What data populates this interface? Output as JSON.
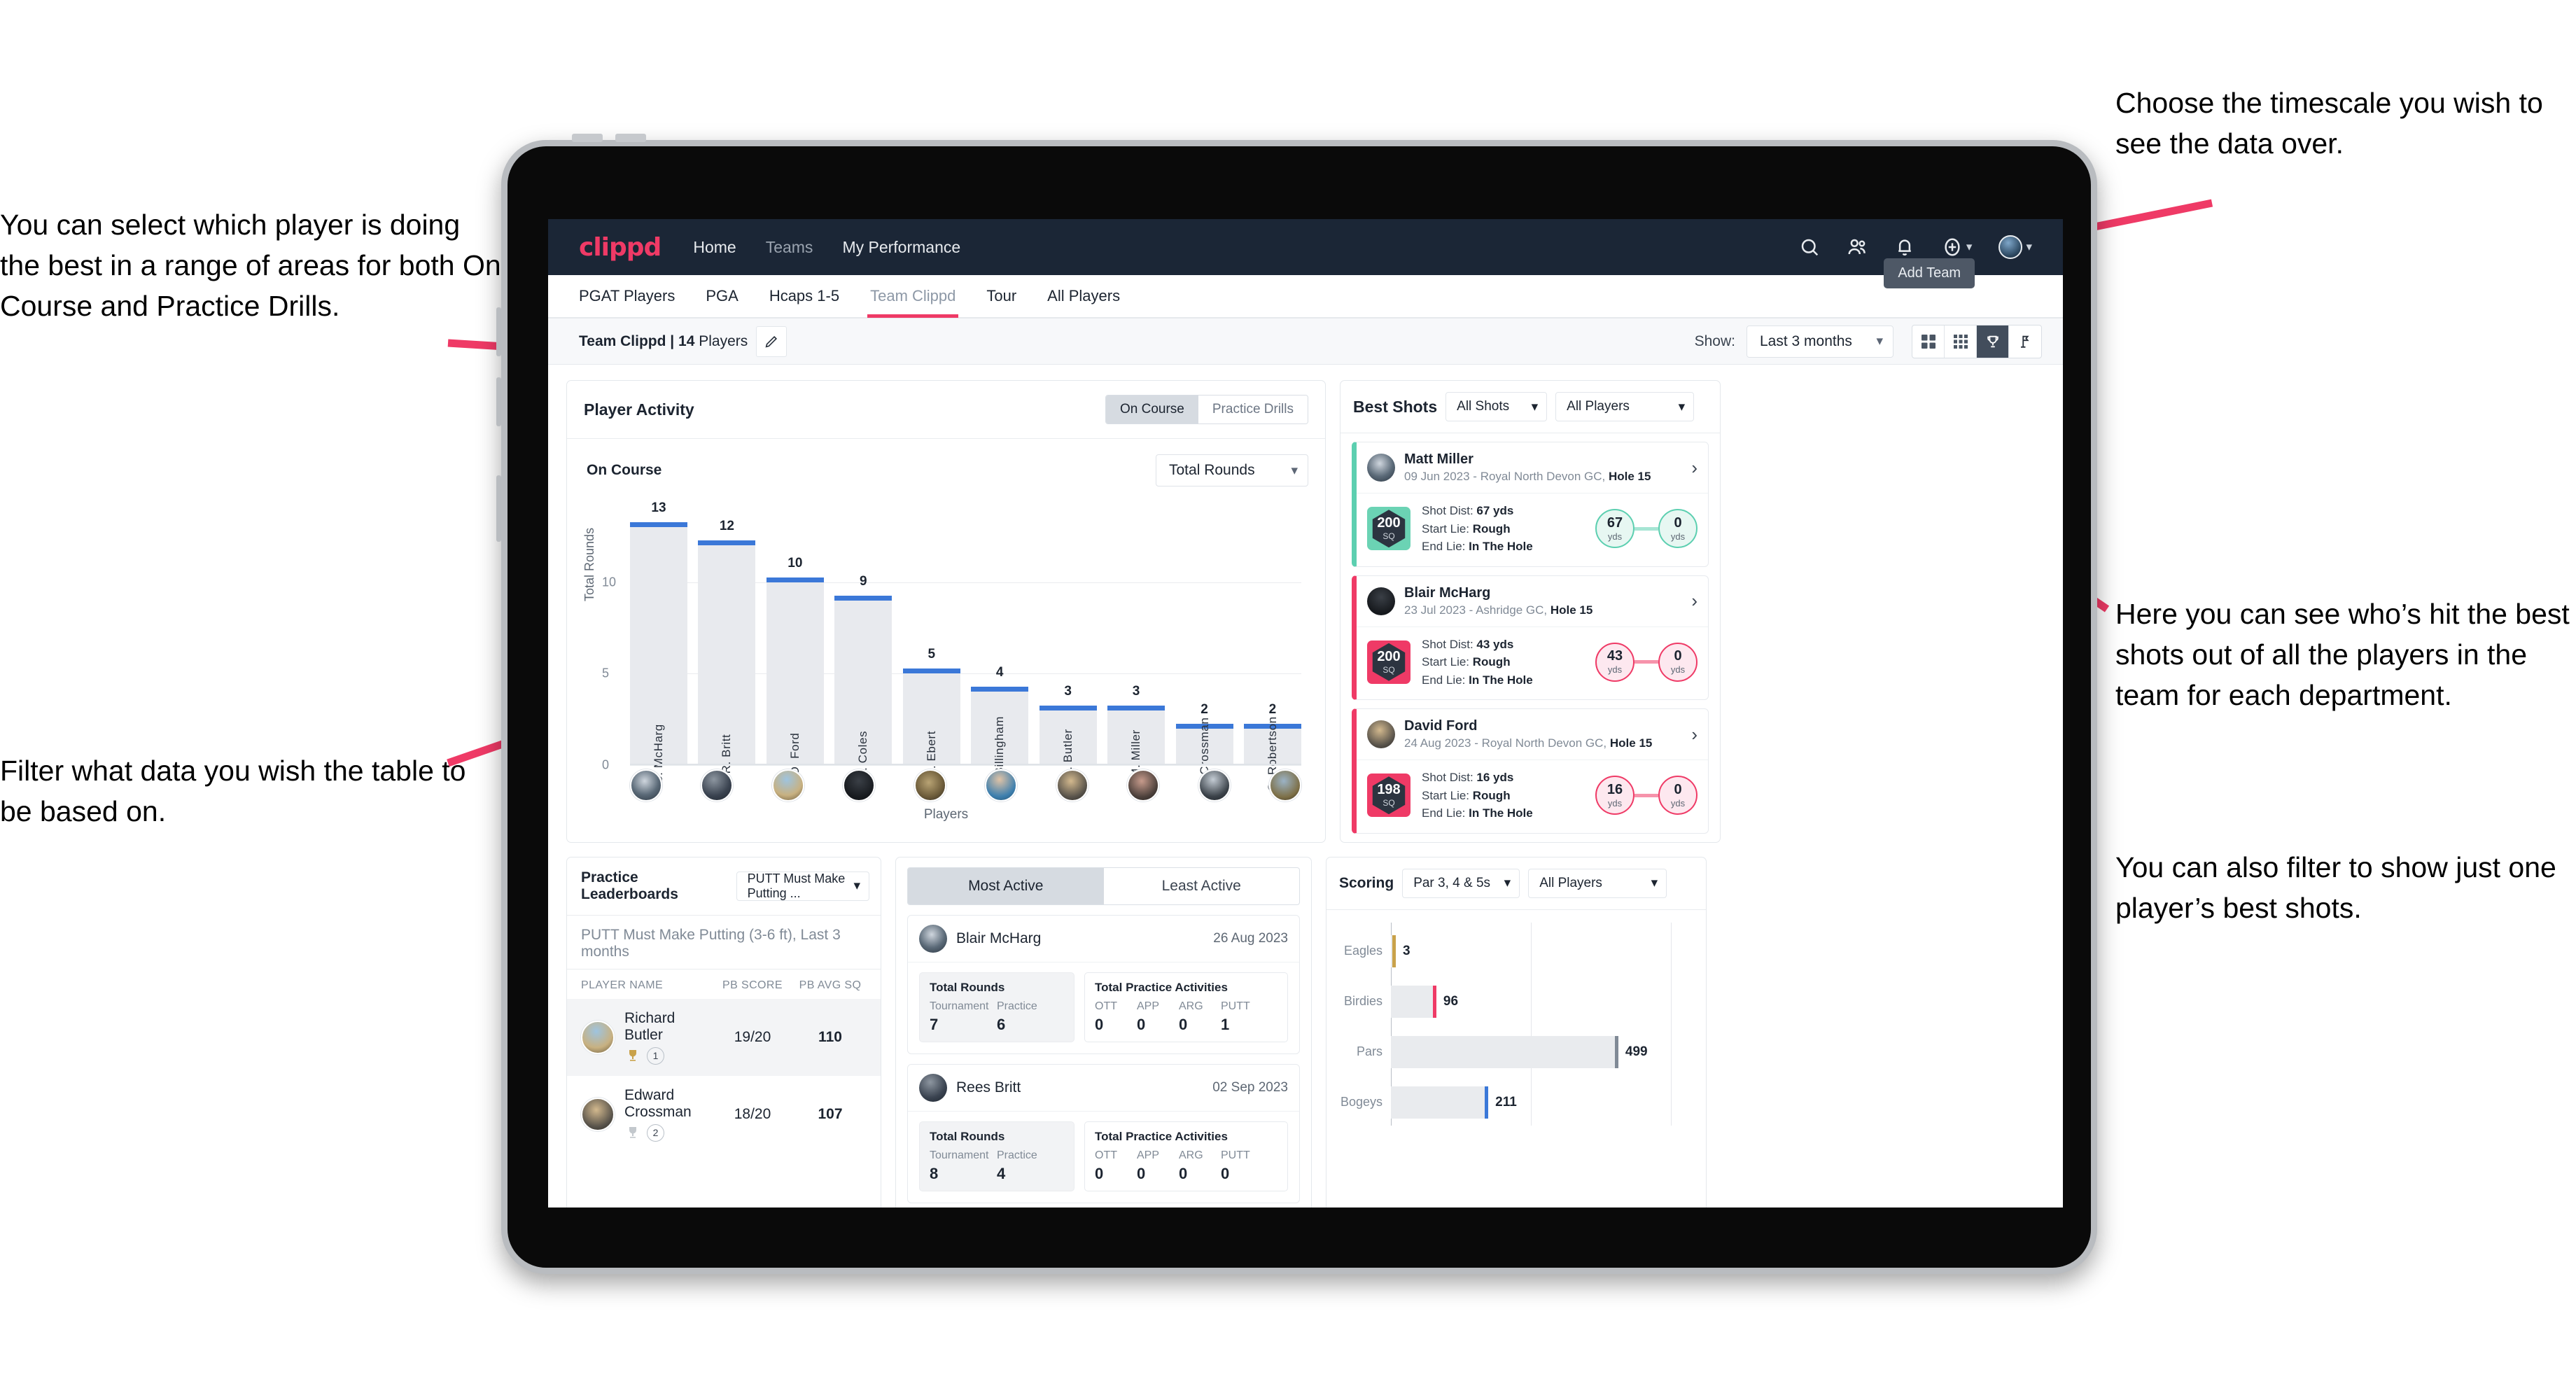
{
  "annotations": {
    "left_top": "You can select which player is doing the best in a range of areas for both On Course and Practice Drills.",
    "left_bottom": "Filter what data you wish the table to be based on.",
    "right_top": "Choose the timescale you wish to see the data over.",
    "right_middle": "Here you can see who’s hit the best shots out of all the players in the team for each department.",
    "right_bottom": "You can also filter to show just one player’s best shots."
  },
  "navbar": {
    "brand": "clippd",
    "links": [
      {
        "label": "Home",
        "active": true
      },
      {
        "label": "Teams",
        "active": false
      },
      {
        "label": "My Performance",
        "active": true
      }
    ],
    "icons": [
      "search-icon",
      "people-icon",
      "bell-icon",
      "plus-circle-icon",
      "avatar"
    ]
  },
  "tabs": [
    {
      "label": "PGAT Players",
      "active": false
    },
    {
      "label": "PGA",
      "active": false
    },
    {
      "label": "Hcaps 1-5",
      "active": false
    },
    {
      "label": "Team Clippd",
      "active": true
    },
    {
      "label": "Tour",
      "active": false
    },
    {
      "label": "All Players",
      "active": false
    }
  ],
  "tooltip": {
    "add_team": "Add Team"
  },
  "subbar": {
    "team_name": "Team Clippd",
    "separator": "|",
    "player_count": "14",
    "players_word": "Players",
    "show_label": "Show:",
    "timescale": "Last 3 months",
    "view_buttons": [
      "grid-large-icon",
      "grid-small-icon",
      "trophy-icon",
      "flag-icon"
    ],
    "selected_view": "trophy-icon"
  },
  "player_activity": {
    "title": "Player Activity",
    "segments": [
      {
        "label": "On Course",
        "active": true
      },
      {
        "label": "Practice Drills",
        "active": false
      }
    ],
    "sub_label": "On Course",
    "metric_select": "Total Rounds"
  },
  "best_shots": {
    "title": "Best Shots",
    "shot_filter": "All Shots",
    "player_filter": "All Players",
    "cards": [
      {
        "player": "Matt Miller",
        "meta_date": "09 Jun 2023",
        "meta_course": "Royal North Devon GC,",
        "meta_hole": "Hole 15",
        "sq": "200",
        "sq_unit": "SQ",
        "shot_dist_label": "Shot Dist:",
        "shot_dist": "67 yds",
        "start_lie_label": "Start Lie:",
        "start_lie": "Rough",
        "end_lie_label": "End Lie:",
        "end_lie": "In The Hole",
        "from_value": "67",
        "from_unit": "yds",
        "to_value": "0",
        "to_unit": "yds",
        "accent": "#5ccfb0"
      },
      {
        "player": "Blair McHarg",
        "meta_date": "23 Jul 2023",
        "meta_course": "Ashridge GC,",
        "meta_hole": "Hole 15",
        "sq": "200",
        "sq_unit": "SQ",
        "shot_dist_label": "Shot Dist:",
        "shot_dist": "43 yds",
        "start_lie_label": "Start Lie:",
        "start_lie": "Rough",
        "end_lie_label": "End Lie:",
        "end_lie": "In The Hole",
        "from_value": "43",
        "from_unit": "yds",
        "to_value": "0",
        "to_unit": "yds",
        "accent": "#ef3a66"
      },
      {
        "player": "David Ford",
        "meta_date": "24 Aug 2023",
        "meta_course": "Royal North Devon GC,",
        "meta_hole": "Hole 15",
        "sq": "198",
        "sq_unit": "SQ",
        "shot_dist_label": "Shot Dist:",
        "shot_dist": "16 yds",
        "start_lie_label": "Start Lie:",
        "start_lie": "Rough",
        "end_lie_label": "End Lie:",
        "end_lie": "In The Hole",
        "from_value": "16",
        "from_unit": "yds",
        "to_value": "0",
        "to_unit": "yds",
        "accent": "#ef3a66"
      }
    ]
  },
  "practice_leaderboards": {
    "title": "Practice Leaderboards",
    "drill_select": "PUTT Must Make Putting ...",
    "subtitle_bold": "PUTT Must Make Putting (3-6 ft),",
    "subtitle_light": "Last 3 months",
    "columns": [
      "PLAYER NAME",
      "PB SCORE",
      "PB AVG SQ"
    ],
    "rows": [
      {
        "name": "Richard Butler",
        "rank": "1",
        "pb_score": "19/20",
        "pb_avg_sq": "110",
        "trophy": "gold"
      },
      {
        "name": "Edward Crossman",
        "rank": "2",
        "pb_score": "18/20",
        "pb_avg_sq": "107",
        "trophy": "silver"
      }
    ]
  },
  "activity": {
    "tabs": [
      {
        "label": "Most Active",
        "active": true
      },
      {
        "label": "Least Active",
        "active": false
      }
    ],
    "cards": [
      {
        "player": "Blair McHarg",
        "date": "26 Aug 2023",
        "rounds_title": "Total Rounds",
        "rounds_keys": [
          "Tournament",
          "Practice"
        ],
        "rounds_values": [
          "7",
          "6"
        ],
        "practice_title": "Total Practice Activities",
        "practice_keys": [
          "OTT",
          "APP",
          "ARG",
          "PUTT"
        ],
        "practice_values": [
          "0",
          "0",
          "0",
          "1"
        ]
      },
      {
        "player": "Rees Britt",
        "date": "02 Sep 2023",
        "rounds_title": "Total Rounds",
        "rounds_keys": [
          "Tournament",
          "Practice"
        ],
        "rounds_values": [
          "8",
          "4"
        ],
        "practice_title": "Total Practice Activities",
        "practice_keys": [
          "OTT",
          "APP",
          "ARG",
          "PUTT"
        ],
        "practice_values": [
          "0",
          "0",
          "0",
          "0"
        ]
      }
    ]
  },
  "scoring": {
    "title": "Scoring",
    "par_filter": "Par 3, 4 & 5s",
    "player_filter": "All Players"
  },
  "chart_data": [
    {
      "type": "bar",
      "title": "Player Activity - On Course",
      "categories": [
        "B. McHarg",
        "R. Britt",
        "D. Ford",
        "J. Coles",
        "E. Ebert",
        "D. Billingham",
        "R. Butler",
        "M. Miller",
        "E. Crossman",
        "C. Robertson"
      ],
      "values": [
        13,
        12,
        10,
        9,
        5,
        4,
        3,
        3,
        2,
        2
      ],
      "xlabel": "Players",
      "ylabel": "Total Rounds",
      "ylim": [
        0,
        14
      ],
      "yticks": [
        0,
        5,
        10
      ],
      "grid": true,
      "bar_color": "#e8eaee",
      "cap_color": "#3b78d8"
    },
    {
      "type": "bar",
      "orientation": "horizontal",
      "title": "Scoring",
      "categories": [
        "Eagles",
        "Birdies",
        "Pars",
        "Bogeys"
      ],
      "values": [
        3,
        96,
        499,
        211
      ],
      "xlabel": "",
      "ylabel": "",
      "xlim": [
        0,
        620
      ],
      "grid": true,
      "bar_color": "#e9ebee",
      "tip_colors": [
        "#c9a24a",
        "#ef3a66",
        "#808a96",
        "#3b78d8"
      ]
    }
  ]
}
